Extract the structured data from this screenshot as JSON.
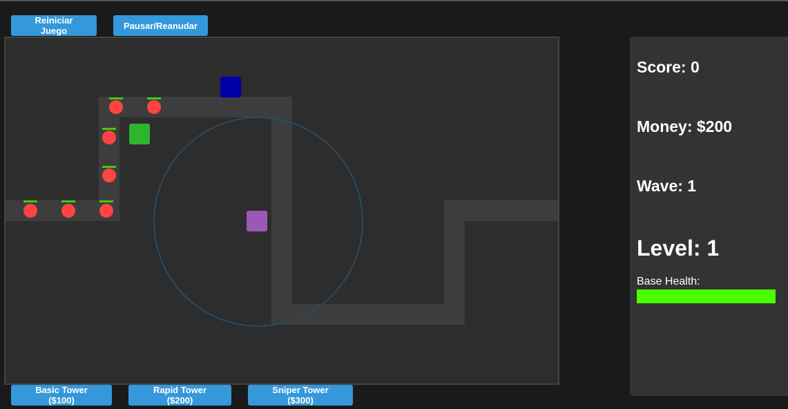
{
  "controls": {
    "restart_label": "Reiniciar Juego",
    "pause_label": "Pausar/Reanudar"
  },
  "shop": {
    "basic_label": "Basic Tower ($100)",
    "rapid_label": "Rapid Tower ($200)",
    "sniper_label": "Sniper Tower ($300)"
  },
  "stats": {
    "score": "Score: 0",
    "money": "Money: $200",
    "wave": "Wave: 1",
    "level": "Level: 1",
    "health_label": "Base Health:",
    "base_health_fraction": 1.0
  },
  "colors": {
    "button": "#3498db",
    "path": "#3d3d3d",
    "enemy": "#ff4444",
    "enemy_health": "#44cc00",
    "tower_basic": "#2db52d",
    "tower_rapid": "#0000aa",
    "tower_sniper": "#9b59b6",
    "range": "#2c4a60",
    "health_bar": "#4cff00"
  },
  "game": {
    "towers": [
      {
        "kind": "basic",
        "icon": "basic-tower-icon"
      },
      {
        "kind": "rapid",
        "icon": "rapid-tower-icon"
      },
      {
        "kind": "sniper",
        "icon": "sniper-tower-icon"
      }
    ],
    "enemy_count": 7
  }
}
